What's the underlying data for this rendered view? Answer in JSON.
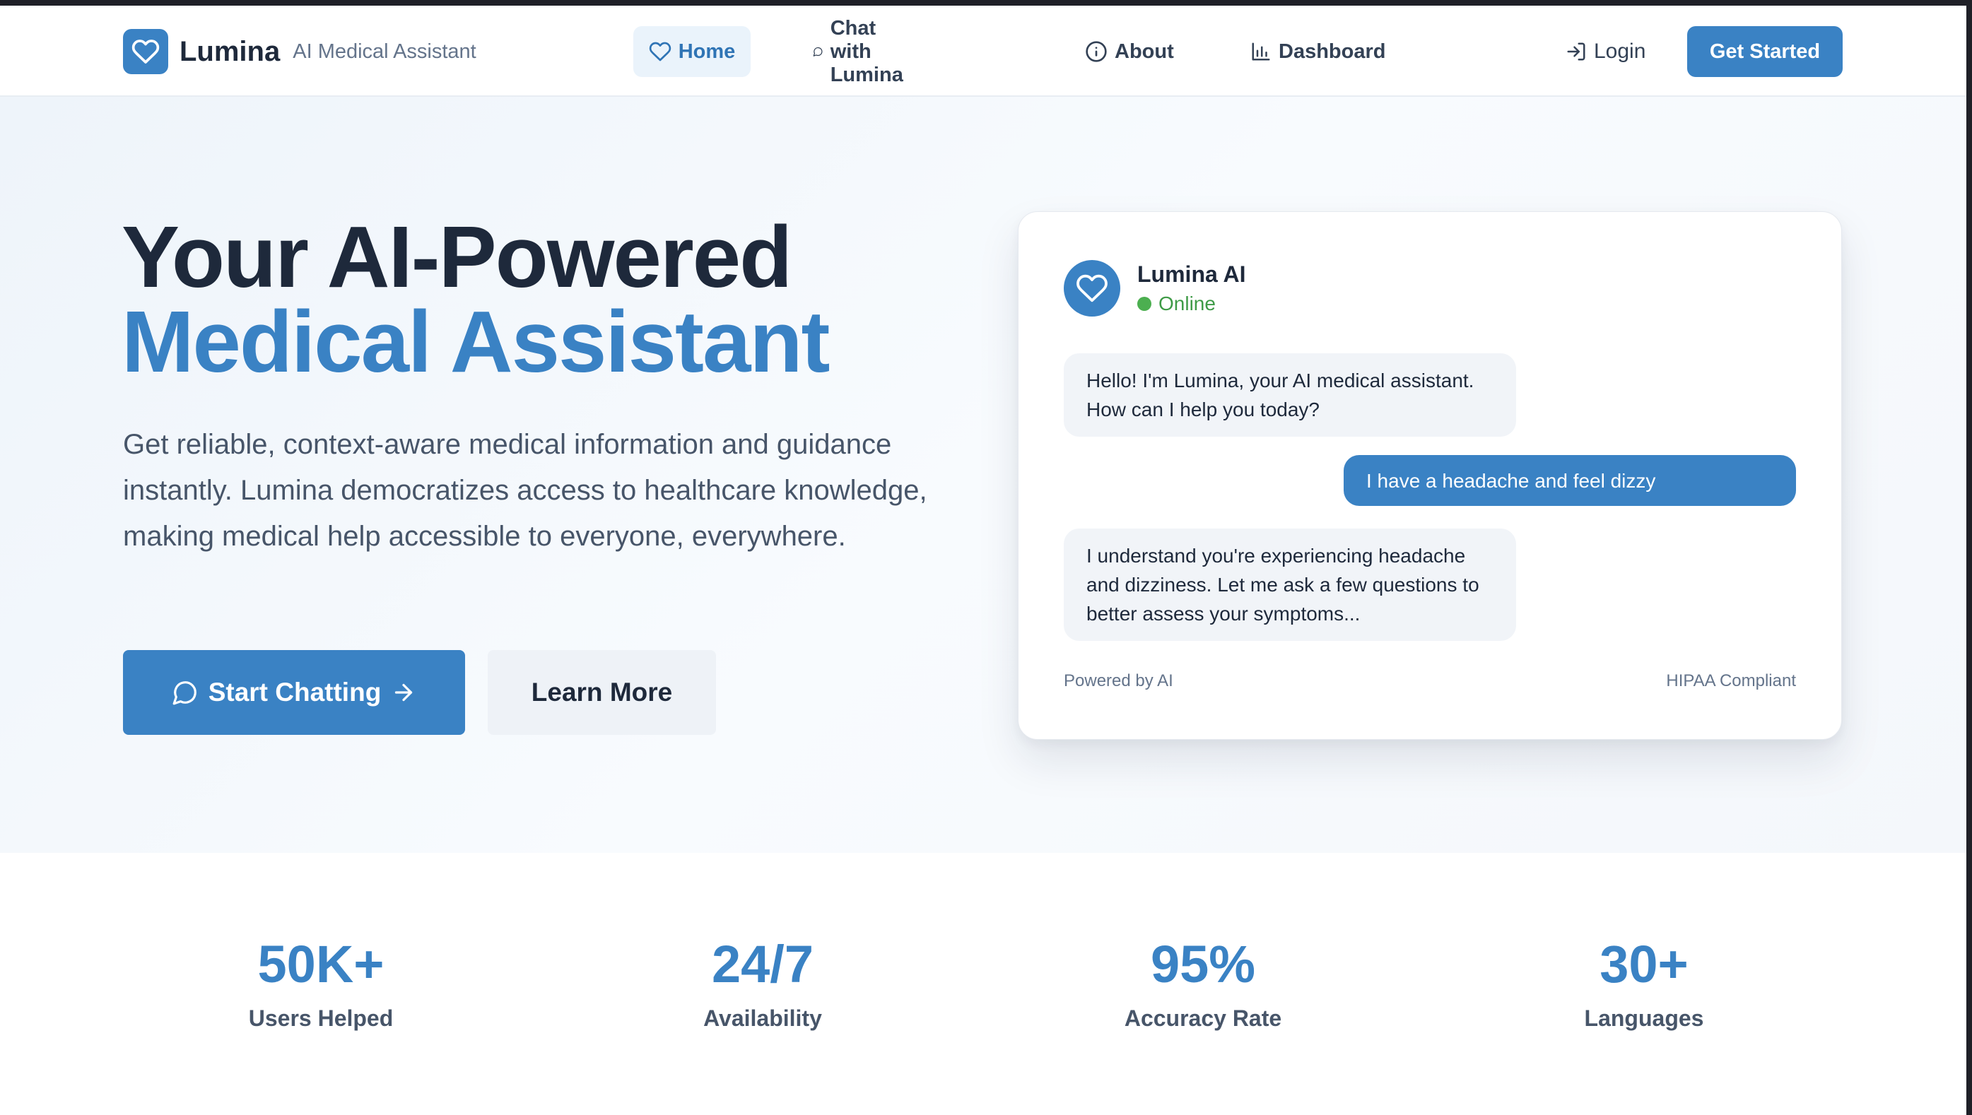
{
  "header": {
    "brand_name": "Lumina",
    "brand_subtitle": "AI Medical Assistant",
    "brand_icon": "heart-icon",
    "nav": [
      {
        "label": "Home",
        "icon": "heart-icon",
        "active": true
      },
      {
        "label": "Chat with Lumina",
        "icon": "chat-bubble-icon",
        "active": false
      },
      {
        "label": "About",
        "icon": "info-circle-icon",
        "active": false
      },
      {
        "label": "Dashboard",
        "icon": "bar-chart-icon",
        "active": false
      }
    ],
    "login_label": "Login",
    "get_started_label": "Get Started"
  },
  "hero": {
    "title_line1": "Your AI-Powered",
    "title_line2": "Medical Assistant",
    "description": "Get reliable, context-aware medical information and guidance instantly. Lumina democratizes access to healthcare knowledge, making medical help accessible to everyone, everywhere.",
    "primary_button": "Start Chatting",
    "secondary_button": "Learn More"
  },
  "chat_preview": {
    "assistant_name": "Lumina AI",
    "status": "Online",
    "messages": [
      {
        "from": "ai",
        "text": "Hello! I'm Lumina, your AI medical assistant. How can I help you today?"
      },
      {
        "from": "user",
        "text": "I have a headache and feel dizzy"
      },
      {
        "from": "ai",
        "text": "I understand you're experiencing headache and dizziness. Let me ask a few questions to better assess your symptoms..."
      }
    ],
    "footer_left": "Powered by AI",
    "footer_right": "HIPAA Compliant"
  },
  "stats": [
    {
      "value": "50K+",
      "label": "Users Helped"
    },
    {
      "value": "24/7",
      "label": "Availability"
    },
    {
      "value": "95%",
      "label": "Accuracy Rate"
    },
    {
      "value": "30+",
      "label": "Languages"
    }
  ],
  "colors": {
    "accent": "#3a82c4",
    "online": "#4caf50",
    "text_dark": "#1e293b"
  }
}
